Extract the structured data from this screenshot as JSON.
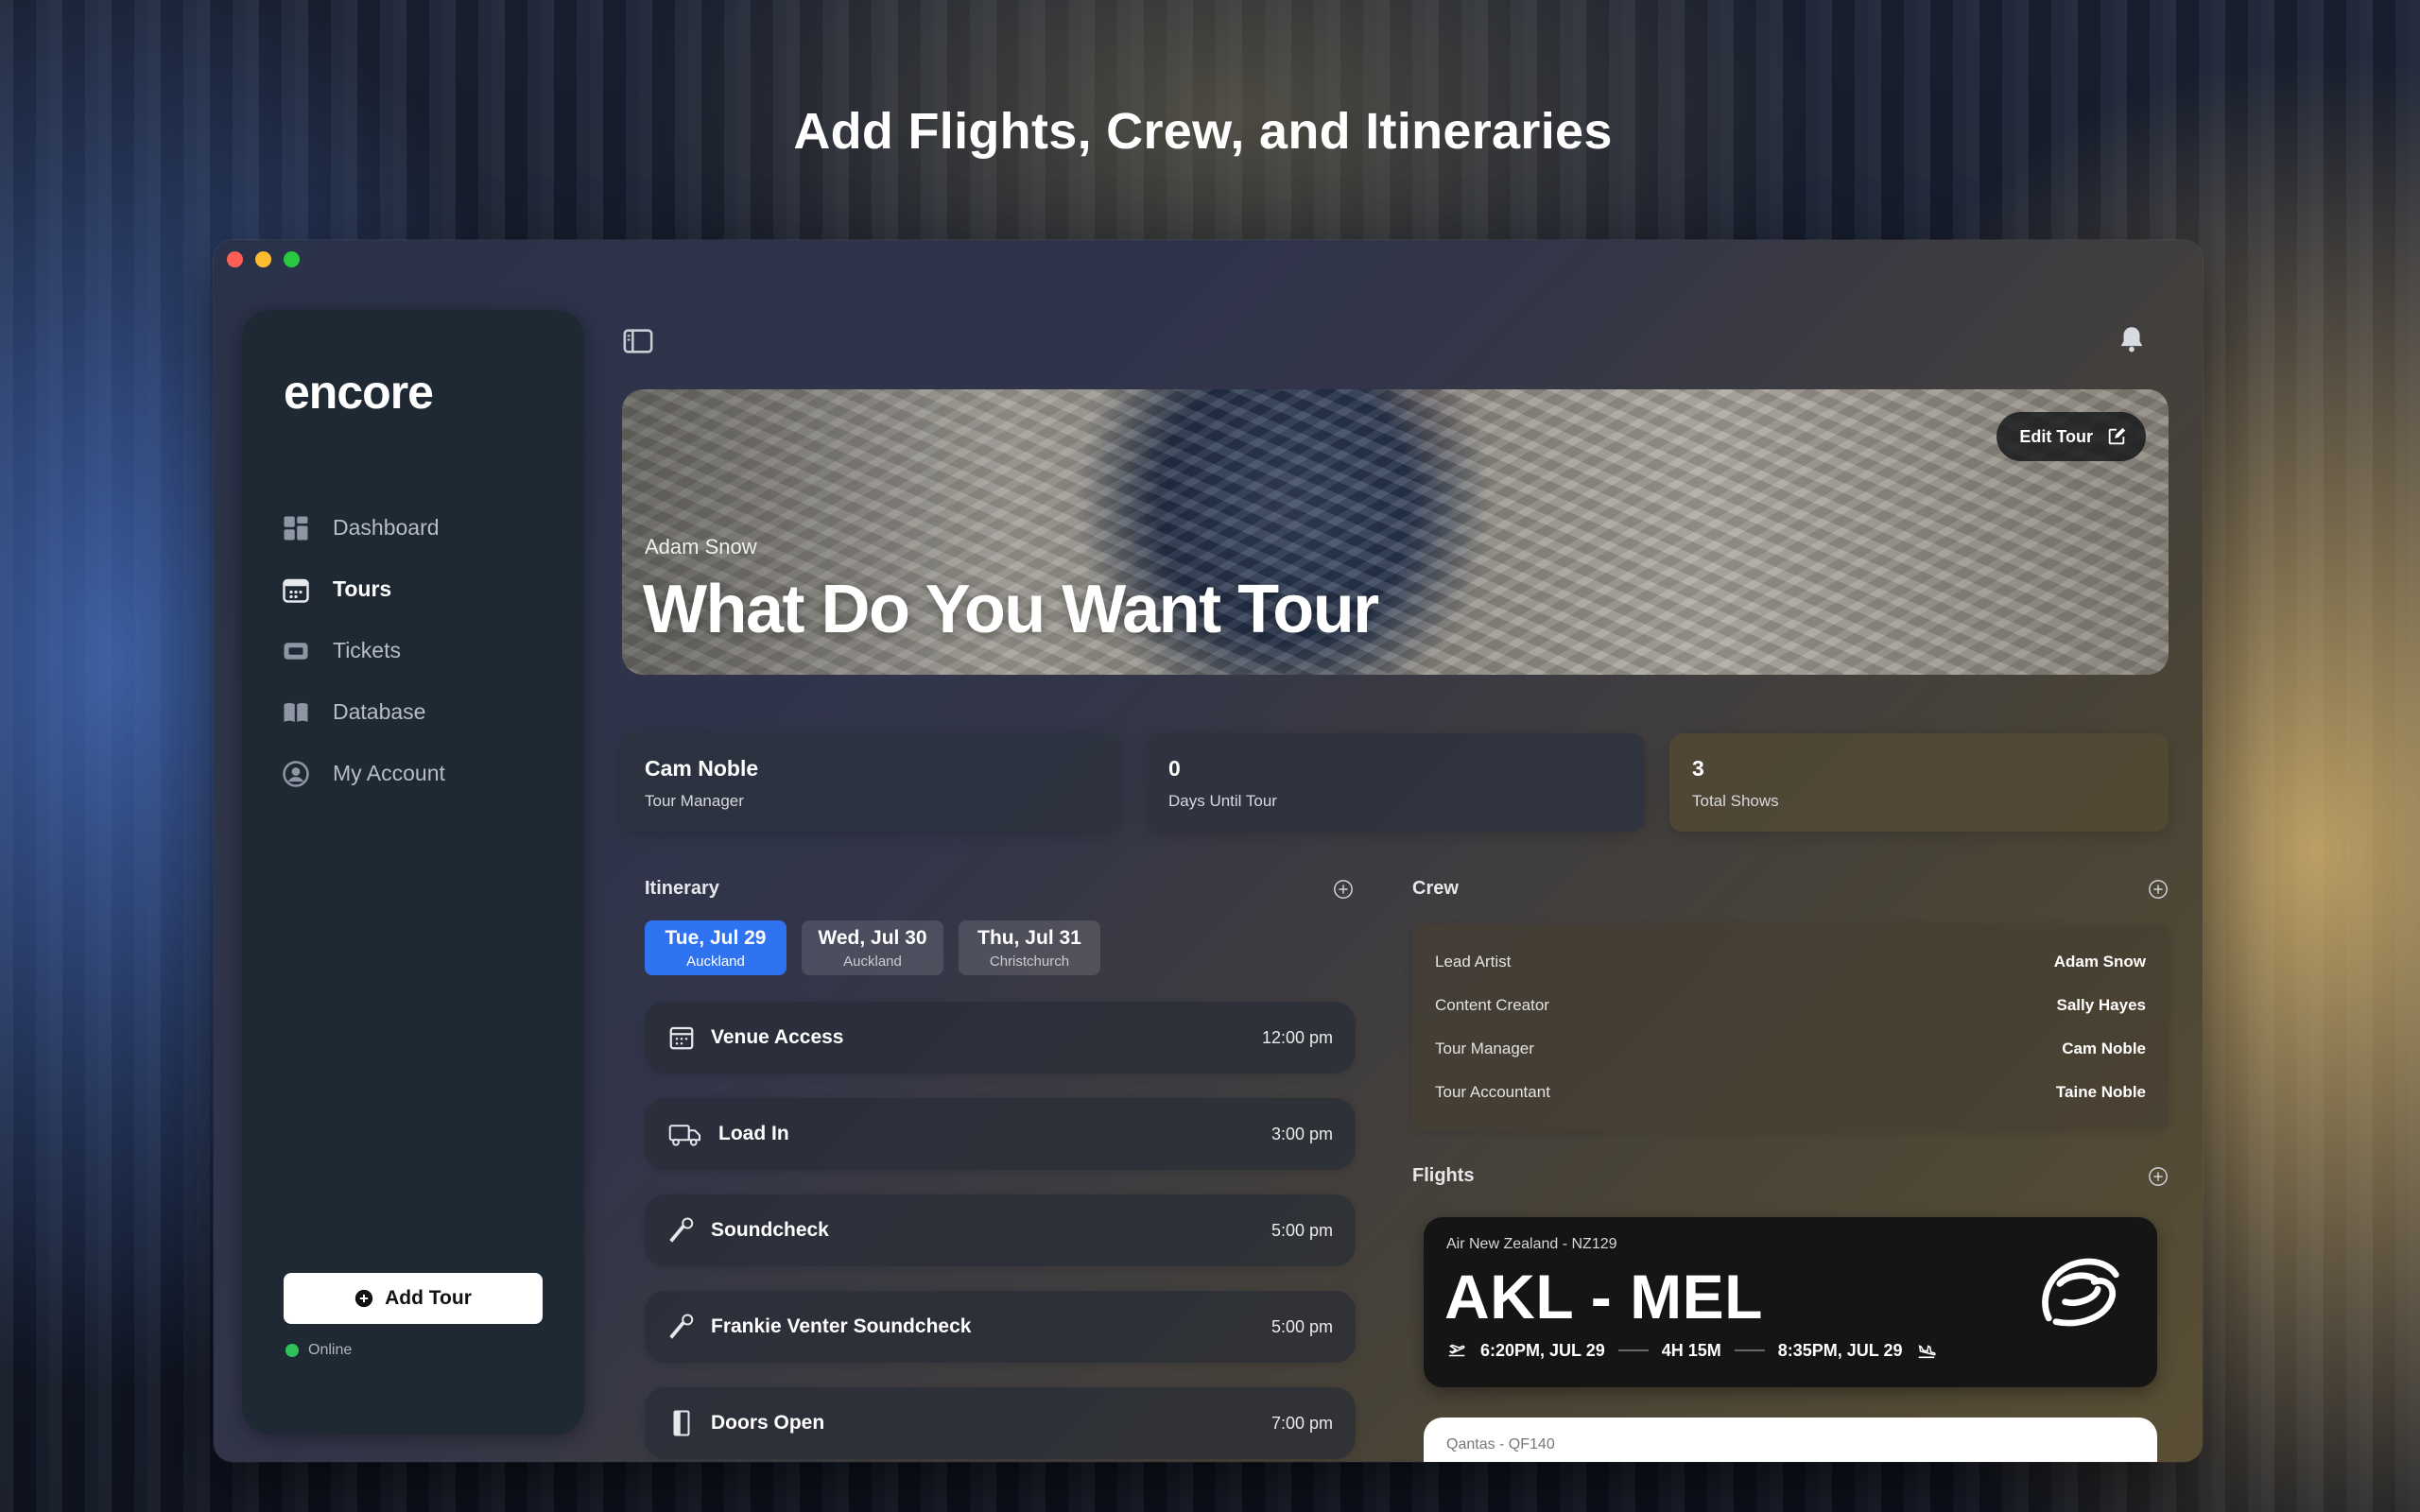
{
  "headline": "Add Flights, Crew, and Itineraries",
  "colors": {
    "accent": "#2f73f0",
    "online": "#2fc15a"
  },
  "sidebar": {
    "logo": "encore",
    "items": [
      {
        "label": "Dashboard",
        "icon": "dashboard-icon"
      },
      {
        "label": "Tours",
        "icon": "calendar-icon",
        "active": true
      },
      {
        "label": "Tickets",
        "icon": "ticket-icon"
      },
      {
        "label": "Database",
        "icon": "book-icon"
      },
      {
        "label": "My Account",
        "icon": "user-circle-icon"
      }
    ],
    "add_tour": "Add Tour",
    "status": "Online"
  },
  "hero": {
    "artist": "Adam Snow",
    "title": "What Do You Want Tour",
    "edit_label": "Edit Tour"
  },
  "stats": [
    {
      "value": "Cam Noble",
      "label": "Tour Manager"
    },
    {
      "value": "0",
      "label": "Days Until Tour"
    },
    {
      "value": "3",
      "label": "Total Shows"
    }
  ],
  "itinerary": {
    "title": "Itinerary",
    "days": [
      {
        "date": "Tue, Jul 29",
        "city": "Auckland",
        "selected": true
      },
      {
        "date": "Wed, Jul 30",
        "city": "Auckland"
      },
      {
        "date": "Thu, Jul 31",
        "city": "Christchurch"
      }
    ],
    "events": [
      {
        "name": "Venue Access",
        "time": "12:00 pm",
        "icon": "calendar-icon"
      },
      {
        "name": "Load In",
        "time": "3:00 pm",
        "icon": "truck-icon"
      },
      {
        "name": "Soundcheck",
        "time": "5:00 pm",
        "icon": "microphone-icon"
      },
      {
        "name": "Frankie Venter Soundcheck",
        "time": "5:00 pm",
        "icon": "microphone-icon"
      },
      {
        "name": "Doors Open",
        "time": "7:00 pm",
        "icon": "door-icon"
      }
    ]
  },
  "crew": {
    "title": "Crew",
    "members": [
      {
        "role": "Lead Artist",
        "name": "Adam Snow"
      },
      {
        "role": "Content Creator",
        "name": "Sally Hayes"
      },
      {
        "role": "Tour Manager",
        "name": "Cam Noble"
      },
      {
        "role": "Tour Accountant",
        "name": "Taine Noble"
      }
    ]
  },
  "flights": {
    "title": "Flights",
    "items": [
      {
        "airline": "Air New Zealand - NZ129",
        "route": "AKL - MEL",
        "depart": "6:20PM, JUL 29",
        "duration": "4H 15M",
        "arrive": "8:35PM, JUL 29"
      },
      {
        "airline": "Qantas - QF140"
      }
    ]
  }
}
